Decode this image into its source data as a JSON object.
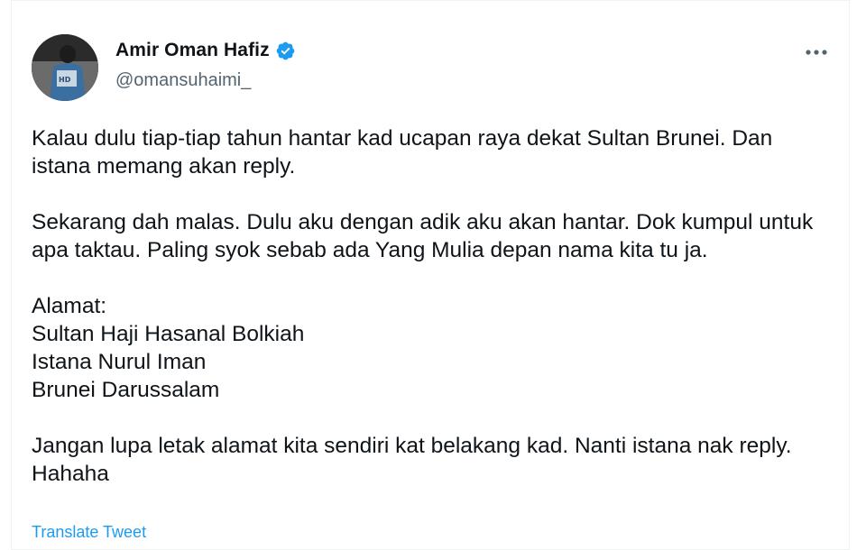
{
  "author": {
    "display_name": "Amir Oman Hafiz",
    "handle": "@omansuhaimi_",
    "verified": true,
    "avatar_icon": "profile-photo",
    "verified_icon": "verified-badge-icon",
    "more_icon": "more-options-icon"
  },
  "tweet": {
    "paragraphs": [
      "Kalau dulu tiap-tiap tahun hantar kad ucapan raya dekat Sultan Brunei. Dan istana memang akan reply.",
      "Sekarang dah malas. Dulu aku dengan adik aku akan hantar. Dok kumpul untuk apa taktau. Paling syok sebab ada Yang Mulia depan nama kita tu ja.",
      "Alamat:\nSultan Haji Hasanal Bolkiah\nIstana Nurul Iman\nBrunei Darussalam",
      "Jangan lupa letak alamat kita sendiri kat belakang kad. Nanti istana nak reply. Hahaha"
    ],
    "translate_label": "Translate Tweet"
  },
  "colors": {
    "text": "#0f1419",
    "secondary": "#536471",
    "link": "#1d9bf0",
    "verified": "#1d9bf0"
  }
}
